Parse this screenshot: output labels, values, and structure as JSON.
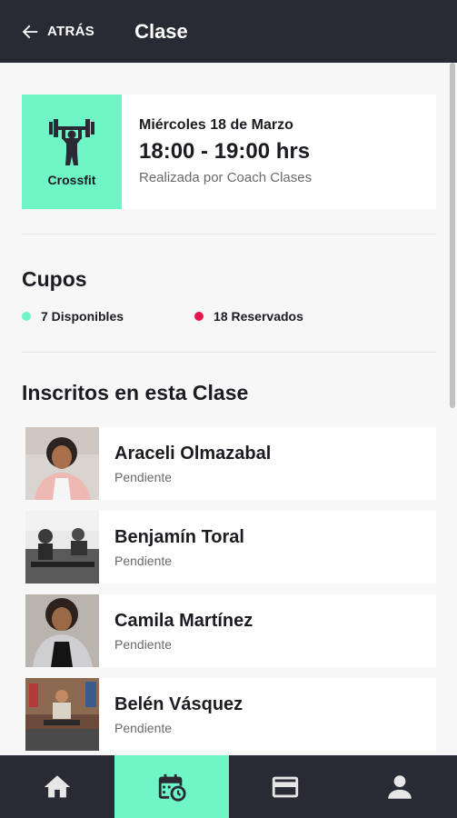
{
  "header": {
    "back_label": "ATRÁS",
    "title": "Clase"
  },
  "class_card": {
    "type": "Crossfit",
    "date": "Miércoles 18 de Marzo",
    "time": "18:00 - 19:00 hrs",
    "coach": "Realizada por Coach Clases",
    "icon": "weightlifter-icon",
    "accent": "#6ff5c6"
  },
  "slots": {
    "title": "Cupos",
    "available": {
      "label": "7 Disponibles",
      "color": "#6ff5c6"
    },
    "reserved": {
      "label": "18 Reservados",
      "color": "#e8164f"
    }
  },
  "members": {
    "title": "Inscritos en esta Clase",
    "items": [
      {
        "name": "Araceli Olmazabal",
        "status": "Pendiente"
      },
      {
        "name": "Benjamín Toral",
        "status": "Pendiente"
      },
      {
        "name": "Camila Martínez",
        "status": "Pendiente"
      },
      {
        "name": "Belén Vásquez",
        "status": "Pendiente"
      }
    ]
  },
  "bottom_nav": [
    {
      "icon": "home-icon",
      "active": false
    },
    {
      "icon": "calendar-clock-icon",
      "active": true
    },
    {
      "icon": "credit-card-icon",
      "active": false
    },
    {
      "icon": "user-icon",
      "active": false
    }
  ]
}
